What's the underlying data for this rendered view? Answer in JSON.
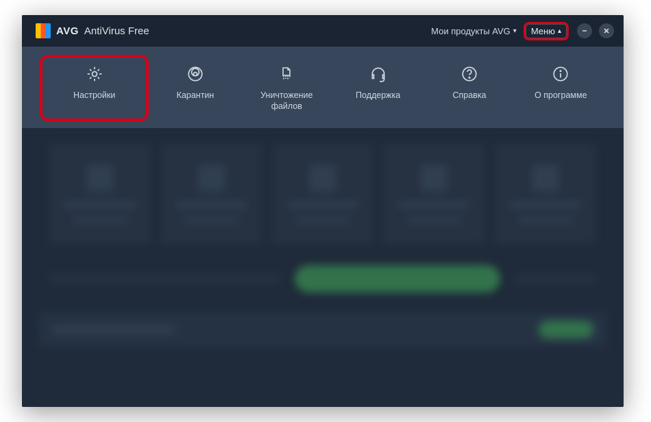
{
  "titlebar": {
    "brand": "AVG",
    "product": "AntiVirus Free",
    "my_products": "Мои продукты AVG",
    "menu_label": "Меню"
  },
  "menu": {
    "items": [
      {
        "label": "Настройки",
        "icon": "gear-icon"
      },
      {
        "label": "Карантин",
        "icon": "biohazard-icon"
      },
      {
        "label": "Уничтожение файлов",
        "icon": "shred-icon"
      },
      {
        "label": "Поддержка",
        "icon": "headset-icon"
      },
      {
        "label": "Справка",
        "icon": "help-icon"
      },
      {
        "label": "О программе",
        "icon": "info-icon"
      }
    ]
  },
  "colors": {
    "highlight": "#d6041a",
    "bg_dark": "#1f2a3a",
    "bg_strip": "#37465a",
    "accent_green": "#3d9a55"
  }
}
